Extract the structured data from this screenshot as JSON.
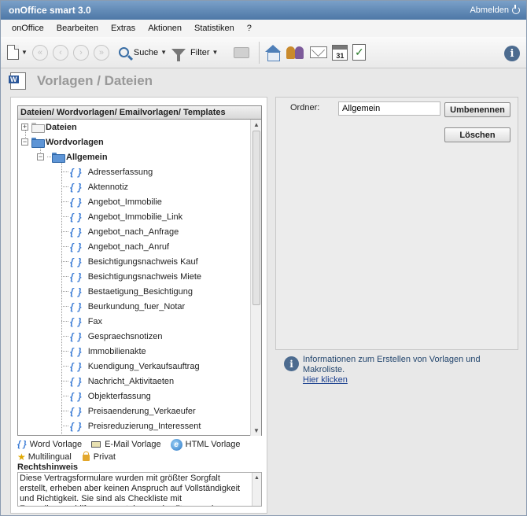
{
  "window": {
    "title": "onOffice smart 3.0",
    "logout_label": "Abmelden"
  },
  "menu": [
    "onOffice",
    "Bearbeiten",
    "Extras",
    "Aktionen",
    "Statistiken",
    "?"
  ],
  "toolbar": {
    "search_label": "Suche",
    "filter_label": "Filter",
    "calendar_day": "31"
  },
  "page": {
    "title": "Vorlagen / Dateien"
  },
  "tree": {
    "header": "Dateien/ Wordvorlagen/ Emailvorlagen/ Templates",
    "dateien": "Dateien",
    "wordvorlagen": "Wordvorlagen",
    "allgemein": "Allgemein",
    "items": [
      "Adresserfassung",
      "Aktennotiz",
      "Angebot_Immobilie",
      "Angebot_Immobilie_Link",
      "Angebot_nach_Anfrage",
      "Angebot_nach_Anruf",
      "Besichtigungsnachweis Kauf",
      "Besichtigungsnachweis Miete",
      "Bestaetigung_Besichtigung",
      "Beurkundung_fuer_Notar",
      "Fax",
      "Gespraechsnotizen",
      "Immobilienakte",
      "Kuendigung_Verkaufsauftrag",
      "Nachricht_Aktivitaeten",
      "Objekterfassung",
      "Preisaenderung_Verkaeufer",
      "Preisreduzierung_Interessent"
    ]
  },
  "legend": {
    "word": "Word Vorlage",
    "email": "E-Mail Vorlage",
    "html": "HTML Vorlage",
    "multilingual": "Multilingual",
    "privat": "Privat"
  },
  "rechtshinweis": {
    "title": "Rechtshinweis",
    "text": "Diese Vertragsformulare wurden mit größter Sorgfalt erstellt, erheben aber keinen Anspruch auf Vollständigkeit und Richtigkeit. Sie sind als Checkliste mit Formulierungshilfen zu verstehen und sollten vor der Verwendung geprüft werden."
  },
  "form": {
    "ordner_label": "Ordner:",
    "ordner_value": "Allgemein",
    "rename_button": "Umbenennen",
    "delete_button": "Löschen"
  },
  "info": {
    "text": "Informationen zum Erstellen von Vorlagen und Makroliste.",
    "link": "Hier klicken"
  },
  "colors": {
    "titlebar": "#5a82b0",
    "accent": "#3a7bd5",
    "title_grey": "#999999"
  }
}
